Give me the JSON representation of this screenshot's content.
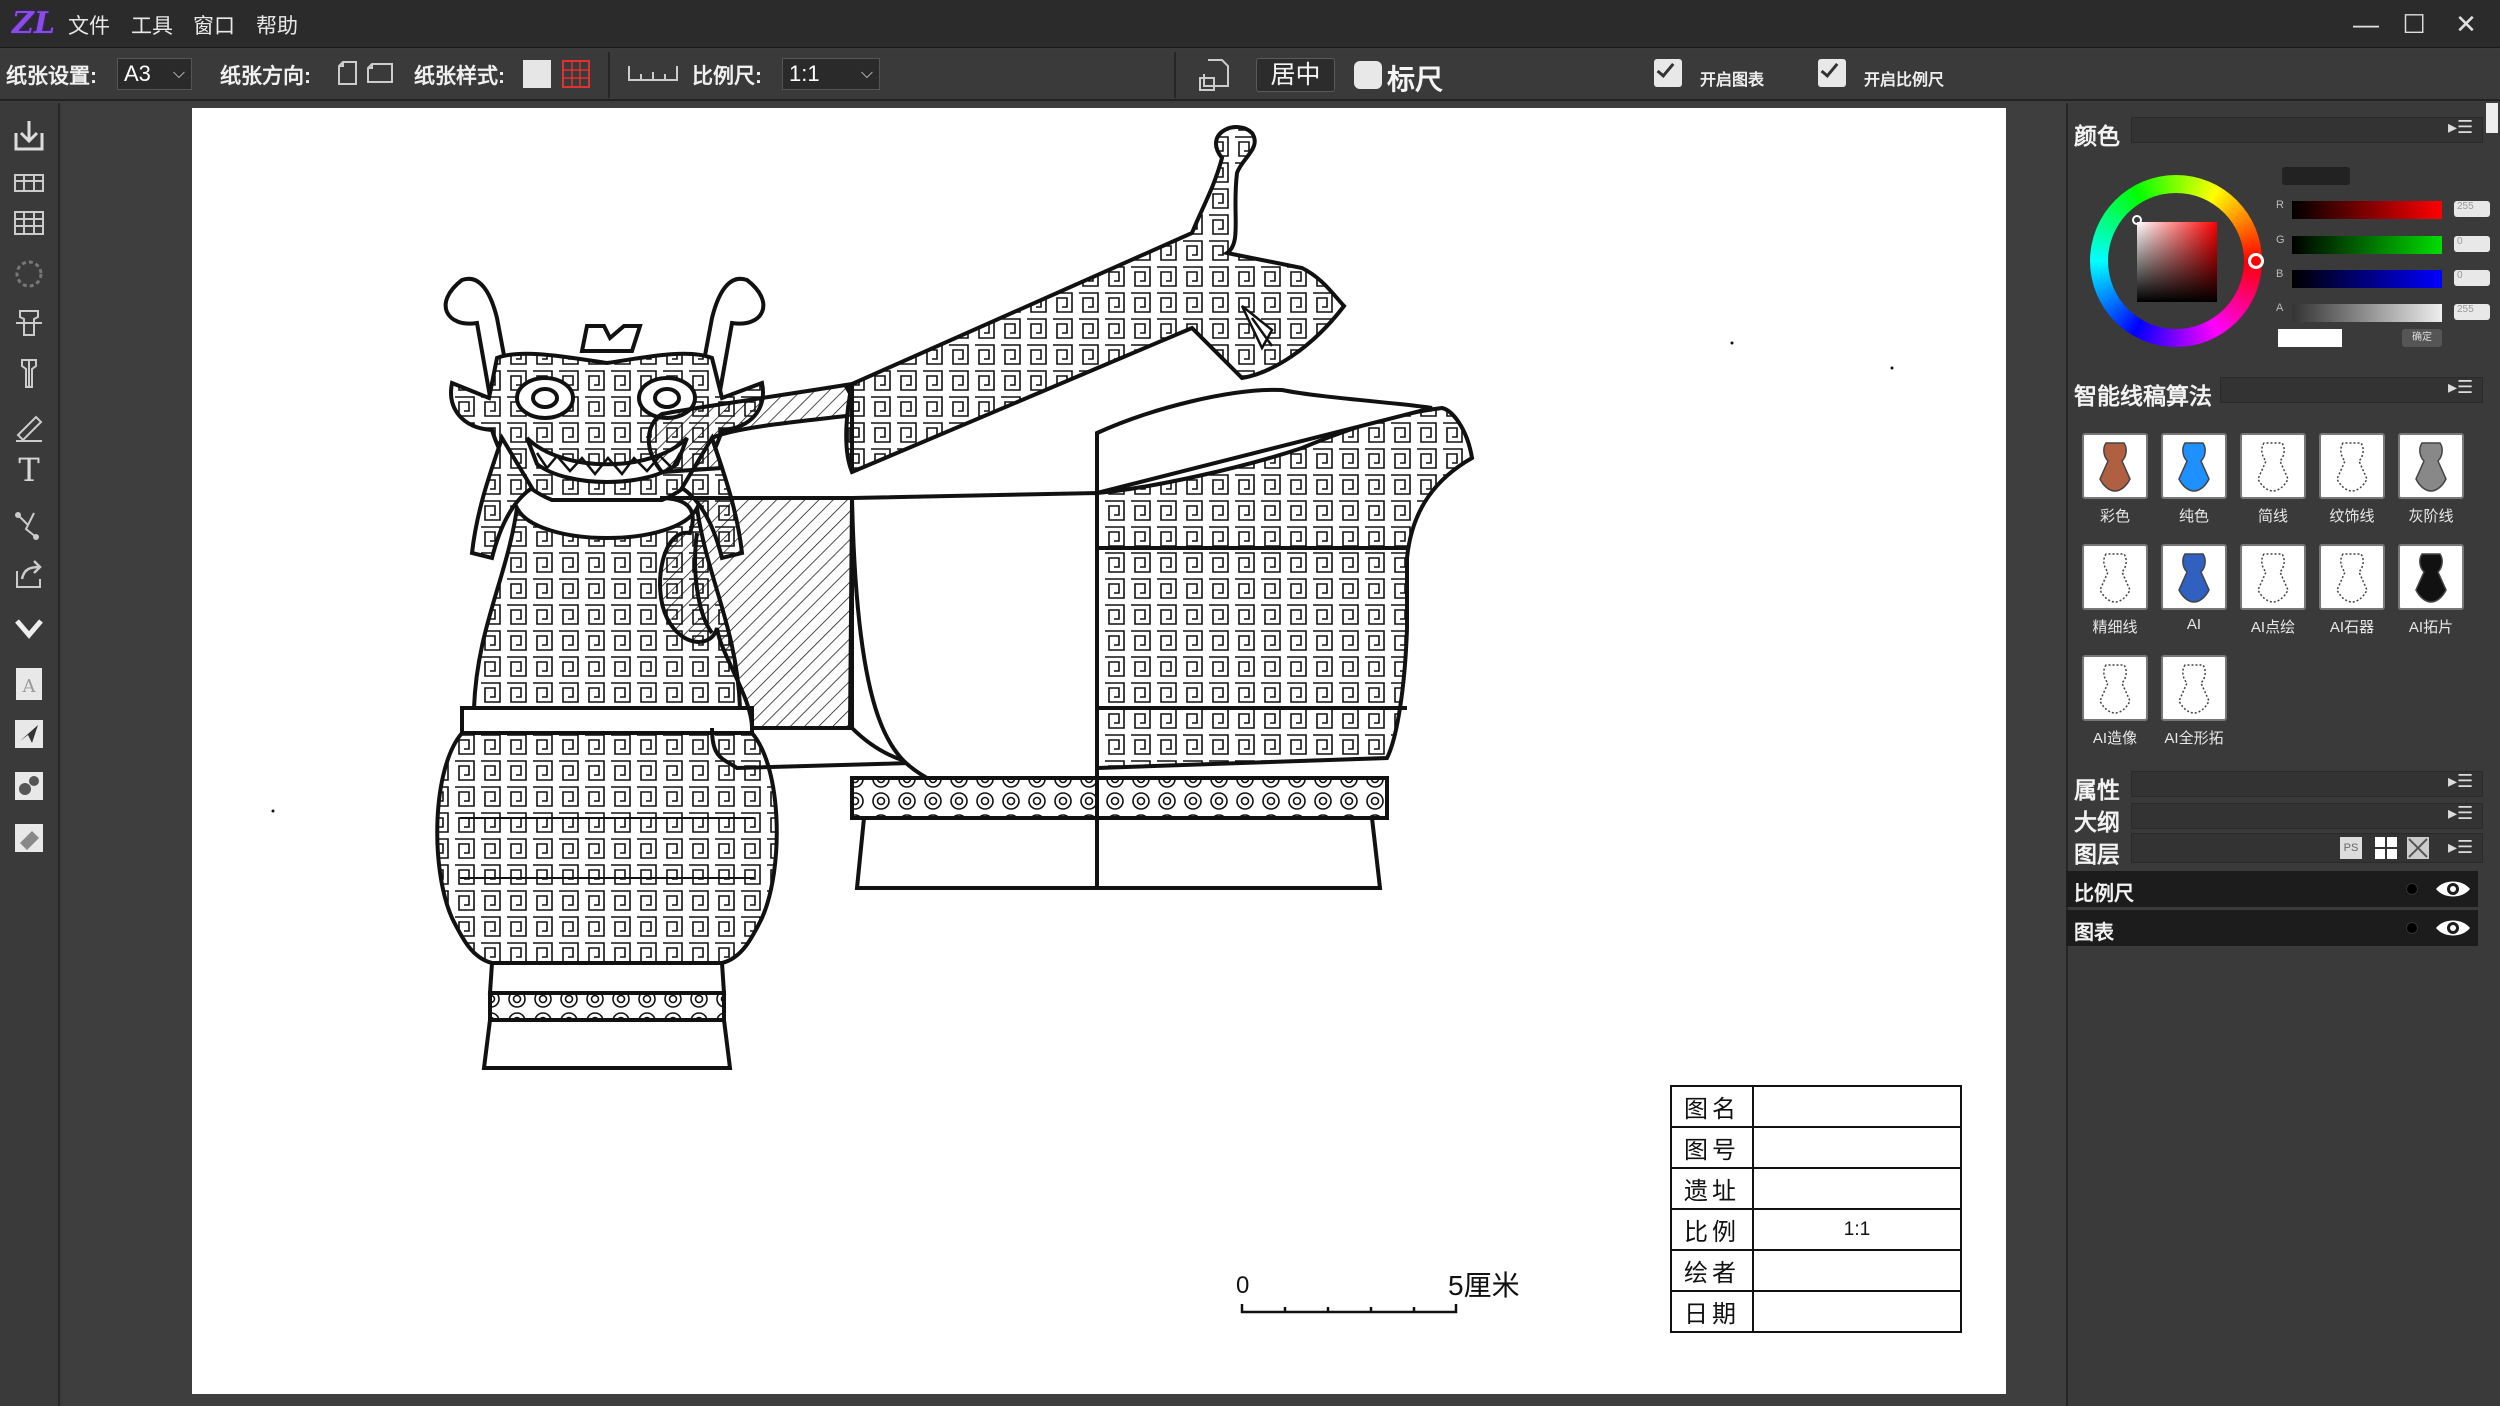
{
  "app": {
    "logo": "ZL"
  },
  "menu": {
    "items": [
      "文件",
      "工具",
      "窗口",
      "帮助"
    ]
  },
  "window_controls": {
    "minimize": "—",
    "maximize": "☐",
    "close": "✕"
  },
  "toolbar": {
    "paper_size_label": "纸张设置:",
    "paper_size_value": "A3",
    "orientation_label": "纸张方向:",
    "paper_style_label": "纸张样式:",
    "scale_label": "比例尺:",
    "scale_value": "1:1",
    "center_button": "居中",
    "ruler_label": "标尺",
    "ruler_checked": false,
    "enable_chart_label": "开启图表",
    "enable_chart_checked": true,
    "enable_scale_label": "开启比例尺",
    "enable_scale_checked": true
  },
  "canvas": {
    "scale_bar": {
      "start": "0",
      "end": "5厘米"
    },
    "title_block": [
      {
        "key": "图名",
        "value": ""
      },
      {
        "key": "图号",
        "value": ""
      },
      {
        "key": "遗址",
        "value": ""
      },
      {
        "key": "比例",
        "value": "1:1"
      },
      {
        "key": "绘者",
        "value": ""
      },
      {
        "key": "日期",
        "value": ""
      }
    ]
  },
  "right_panel": {
    "color": {
      "title": "颜色",
      "channels": [
        {
          "name": "R",
          "value": "255",
          "color": "#ff0000"
        },
        {
          "name": "G",
          "value": "0",
          "color": "#00cc00"
        },
        {
          "name": "B",
          "value": "0",
          "color": "#0000ff"
        },
        {
          "name": "A",
          "value": "255",
          "color": "#dddddd"
        }
      ],
      "apply_button": "确定"
    },
    "algorithm": {
      "title": "智能线稿算法",
      "items": [
        "彩色",
        "纯色",
        "简线",
        "纹饰线",
        "灰阶线",
        "精细线",
        "AI",
        "AI点绘",
        "AI石器",
        "AI拓片",
        "AI造像",
        "AI全形拓"
      ]
    },
    "properties_title": "属性",
    "outline_title": "大纲",
    "layers_title": "图层",
    "layers": [
      {
        "name": "比例尺"
      },
      {
        "name": "图表"
      }
    ]
  }
}
